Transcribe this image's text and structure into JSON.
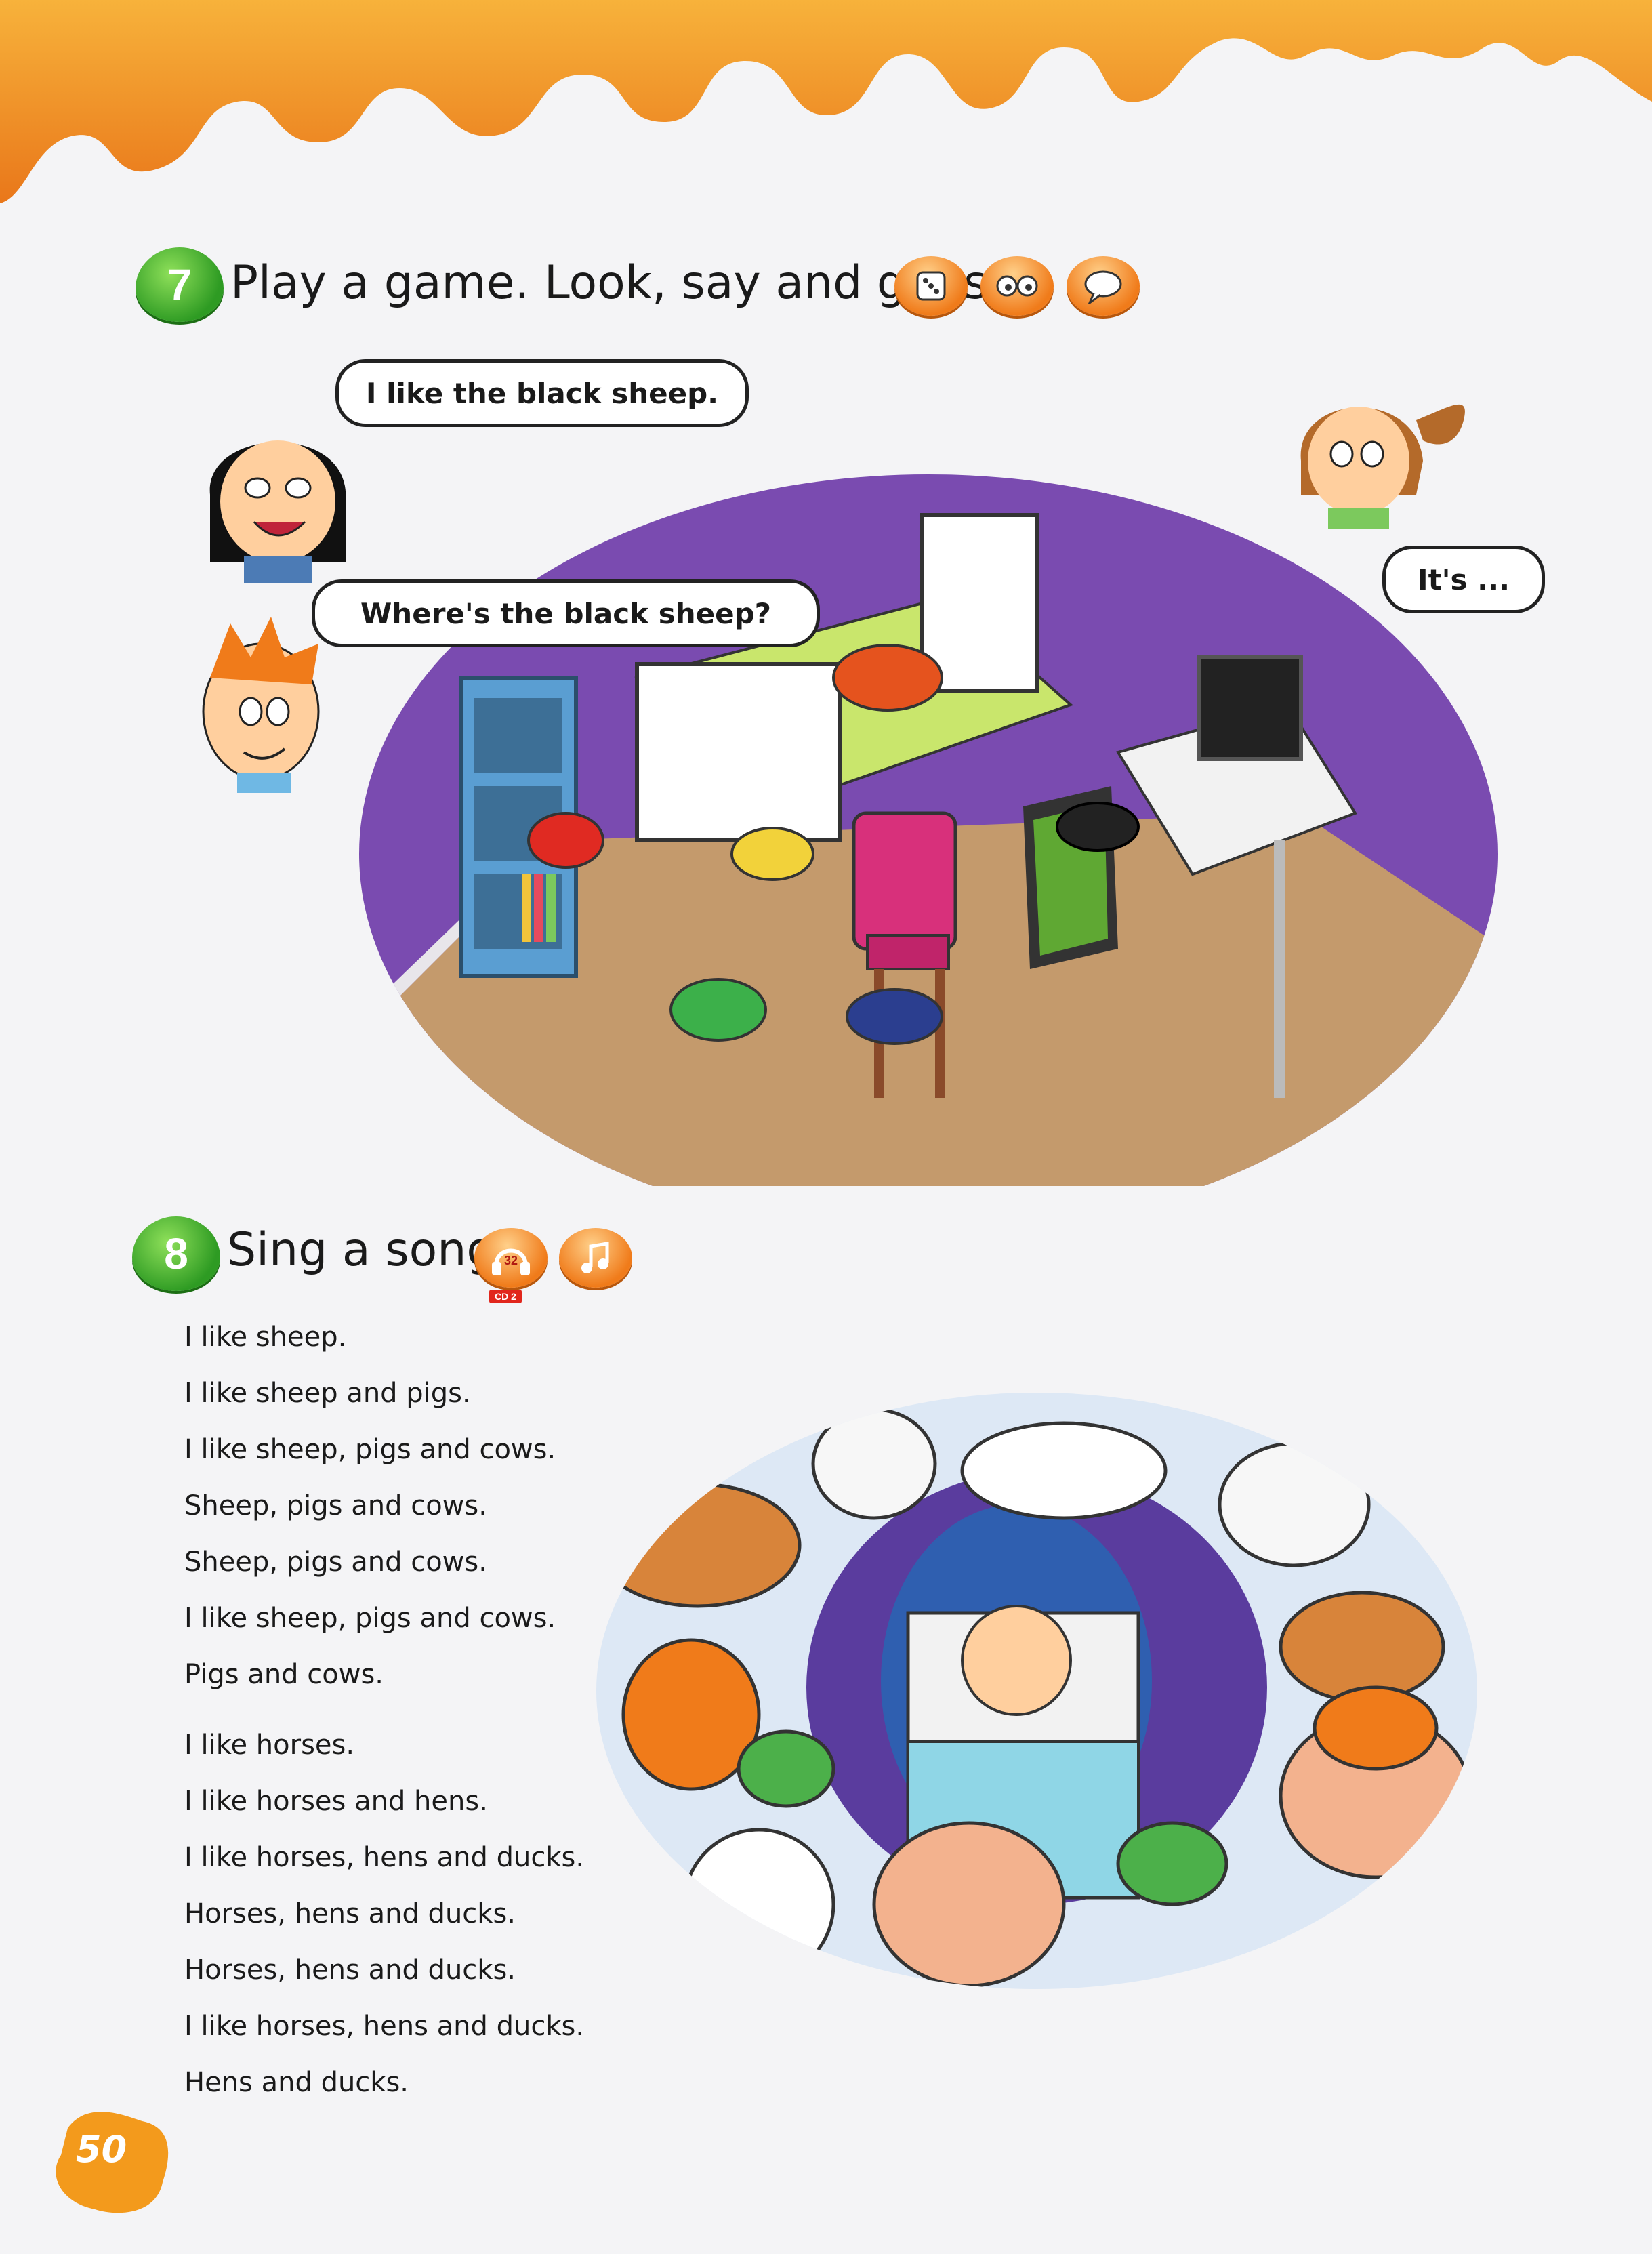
{
  "exercise7": {
    "number": "7",
    "title": "Play a game. Look, say and guess.",
    "icons": [
      "dice-icon",
      "eyes-icon",
      "speech-icon"
    ],
    "bubbles": {
      "girl": "I like the black sheep.",
      "boy": "Where's the black sheep?",
      "girl2": "It's ..."
    }
  },
  "exercise8": {
    "number": "8",
    "title": "Sing a song.",
    "track": "32",
    "cd_label": "CD 2",
    "icons": [
      "headphones-icon",
      "music-note-icon"
    ],
    "lyrics": [
      "I like sheep.",
      "I like sheep and pigs.",
      "I like sheep, pigs and cows.",
      "Sheep, pigs and cows.",
      "Sheep, pigs and cows.",
      "I like sheep, pigs and cows.",
      "Pigs and cows.",
      "I like horses.",
      "I like horses and hens.",
      "I like horses, hens and ducks.",
      "Horses, hens and ducks.",
      "Horses, hens and ducks.",
      "I like horses, hens and ducks.",
      "Hens and ducks."
    ]
  },
  "page_number": "50",
  "colors": {
    "drip_orange": "#f39a1c",
    "badge_green": "#3aa62a",
    "room_purple": "#7a4bb0"
  }
}
